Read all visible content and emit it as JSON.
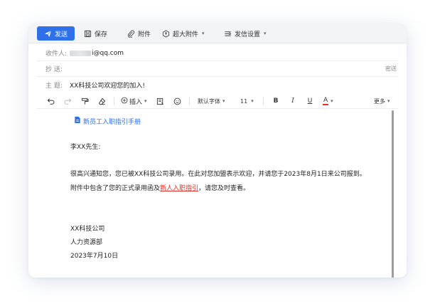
{
  "toolbar": {
    "send_label": "发送",
    "save_label": "保存",
    "attachment_label": "附件",
    "large_attachment_label": "超大附件",
    "send_settings_label": "发信设置"
  },
  "fields": {
    "to_label": "收件人:",
    "to_value": "i@qq.com",
    "cc_label": "抄  送:",
    "bcc_link": "密送",
    "subject_label": "主  题:",
    "subject_value": "XX科技公司欢迎您的加入!"
  },
  "editor_toolbar": {
    "insert_label": "插入",
    "font_family": "默认字体",
    "font_size": "11",
    "bold": "B",
    "italic": "I",
    "underline": "U",
    "font_color": "A",
    "more_label": "更多",
    "font_color_hex": "#e0322b"
  },
  "body": {
    "attachment_name": "新员工入职指引手册",
    "greeting": "李XX先生:",
    "paragraph1": "很高兴通知您，您已被XX科技公司录用。在此对您加盟表示欢迎，并请您于2023年8月1日来公司报到。",
    "paragraph2_prefix": "附件中包含了您的正式录用函及",
    "paragraph2_link": "新人入职指引",
    "paragraph2_suffix": "，请您及时查看。",
    "sign_company": "XX科技公司",
    "sign_dept": "人力资源部",
    "sign_date": "2023年7月10日"
  },
  "colors": {
    "accent": "#2f6fe8",
    "link_red": "#e0322b"
  }
}
